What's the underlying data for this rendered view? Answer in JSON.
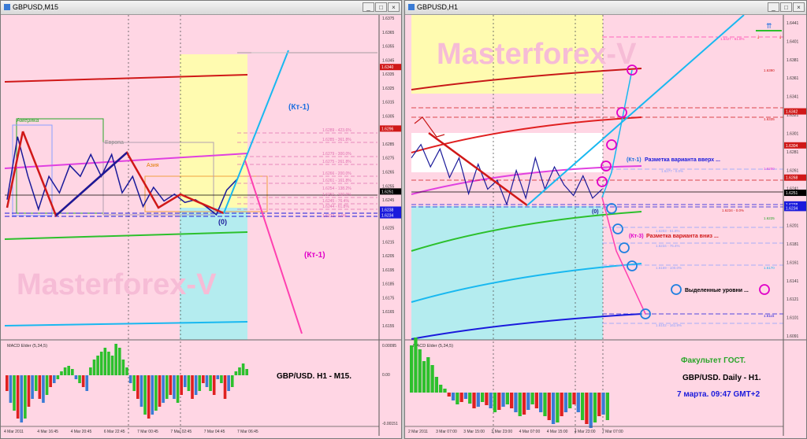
{
  "left": {
    "title": "GBPUSD,M15",
    "buttons": [
      "_",
      "□",
      "×"
    ],
    "price_ticks": [
      "1.6375",
      "1.6365",
      "1.6355",
      "1.6345",
      "1.6335",
      "1.6325",
      "1.6315",
      "1.6305",
      "1.6295",
      "1.6285",
      "1.6275",
      "1.6265",
      "1.6255",
      "1.6245",
      "1.6235",
      "1.6225",
      "1.6215",
      "1.6205",
      "1.6195",
      "1.6185",
      "1.6175",
      "1.6165",
      "1.6155"
    ],
    "price_boxes": [
      {
        "text": "1.6340",
        "color": "#d01818"
      },
      {
        "text": "1.6296",
        "color": "#d01818"
      },
      {
        "text": "1.6251",
        "color": "#000000"
      },
      {
        "text": "1.6238",
        "color": "#1a1adc"
      },
      {
        "text": "1.6234",
        "color": "#1a1adc"
      }
    ],
    "session_labels": [
      {
        "text": "Америка",
        "color": "#2aa52a"
      },
      {
        "text": "Европа",
        "color": "#8a8a8a"
      },
      {
        "text": "Азия",
        "color": "#e07b00"
      }
    ],
    "fib_labels": [
      "1.6289 - 423.6%",
      "1.6285 - 361.8%",
      "1.6279 - 300.0%",
      "1.6275 - 261.8%",
      "1.6266 - 200.0%",
      "1.6261 - 161.8%",
      "1.6254 - 138.2%",
      "1.6251 - 100.0%",
      "1.6245 - 76.4%",
      "1.6244 - 61.8%",
      "1.6232 - 0.0%"
    ],
    "wave_labels": [
      {
        "text": "(Кт-1)",
        "color": "#1e6fe0"
      },
      {
        "text": "(Кт-1)",
        "color": "#e000c8"
      },
      {
        "text": "(0)",
        "color": "#1a1a9a"
      }
    ],
    "watermark": "Masterforex-V",
    "macd_title": "MACD Elder (5,34,5)",
    "macd_ticks": [
      "0.00095",
      "0.00",
      "-0.00151"
    ],
    "annotation": "GBP/USD. H1 - M15.",
    "date_ticks": [
      "4 Mar 2011",
      "4 Mar 16:45",
      "4 Mar 20:45",
      "6 Mar 22:45",
      "7 Mar 00:45",
      "7 Mar 02:45",
      "7 Mar 04:45",
      "7 Mar 06:45"
    ]
  },
  "right": {
    "title": "GBPUSD,H1",
    "buttons": [
      "_",
      "□",
      "×"
    ],
    "price_ticks": [
      "1.6441",
      "1.6401",
      "1.6381",
      "1.6361",
      "1.6341",
      "1.6321",
      "1.6301",
      "1.6281",
      "1.6261",
      "1.6241",
      "1.6221",
      "1.6201",
      "1.6181",
      "1.6161",
      "1.6141",
      "1.6121",
      "1.6101",
      "1.6091"
    ],
    "price_boxes": [
      {
        "text": "1.6342",
        "color": "#d01818"
      },
      {
        "text": "1.6304",
        "color": "#d01818"
      },
      {
        "text": "1.6268",
        "color": "#d01818"
      },
      {
        "text": "1.6251",
        "color": "#000000"
      },
      {
        "text": "1.6238",
        "color": "#1a1adc"
      },
      {
        "text": "1.6234",
        "color": "#1a1adc"
      }
    ],
    "level_labels": [
      "1.6427 - 61.8%",
      "1.6390",
      "1.6335",
      "1.6280",
      "1.6277 - 0.0%",
      "1.6234 - 0.0%",
      "1.6225",
      "1.6203 - 61.8%",
      "1.6234 - 76.4%",
      "1.6169 - 100.0%",
      "1.6170",
      "1.6115",
      "1.6102 - 161.8%"
    ],
    "watermark": "Masterforex-V",
    "kt1_up": "(Кт-1)",
    "kt1_up_text": "Разметка варианта вверх ...",
    "kt3_down": "(Кт-3)",
    "kt3_down_text": "Разметка варианта вниз ...",
    "zero_label": "(0)",
    "legend_text": "Выделенные уровни ...",
    "macd_title": "MACD Elder (5,34,5)",
    "faculty": "Факультет ГОСТ.",
    "pair": "GBP/USD. Daily - H1.",
    "date_text": "7 марта. 09:47 GMT+2",
    "date_ticks": [
      "2 Mar 2011",
      "3 Mar 07:00",
      "3 Mar 15:00",
      "3 Mar 23:00",
      "4 Mar 07:00",
      "4 Mar 15:00",
      "4 Mar 23:00",
      "7 Mar 07:00"
    ]
  },
  "chart_data": [
    {
      "type": "line",
      "title": "GBPUSD,M15",
      "ylim": [
        1.615,
        1.638
      ],
      "series": [
        {
          "name": "price",
          "values": [
            1.6245,
            1.6291,
            1.6262,
            1.6238,
            1.6262,
            1.625,
            1.627,
            1.6262,
            1.6278,
            1.6262,
            1.6278,
            1.625,
            1.6262,
            1.624,
            1.6254,
            1.6244,
            1.6249,
            1.6243,
            1.6245,
            1.624,
            1.6234,
            1.6252,
            1.626
          ]
        }
      ]
    },
    {
      "type": "line",
      "title": "GBPUSD,H1",
      "ylim": [
        1.6091,
        1.6441
      ],
      "series": [
        {
          "name": "price",
          "values": [
            1.629,
            1.6305,
            1.628,
            1.63,
            1.6268,
            1.629,
            1.625,
            1.6283,
            1.6255,
            1.6265,
            1.6238,
            1.6276,
            1.6245,
            1.629,
            1.6255,
            1.628,
            1.626,
            1.6248,
            1.627,
            1.6245,
            1.6255
          ]
        }
      ]
    }
  ]
}
